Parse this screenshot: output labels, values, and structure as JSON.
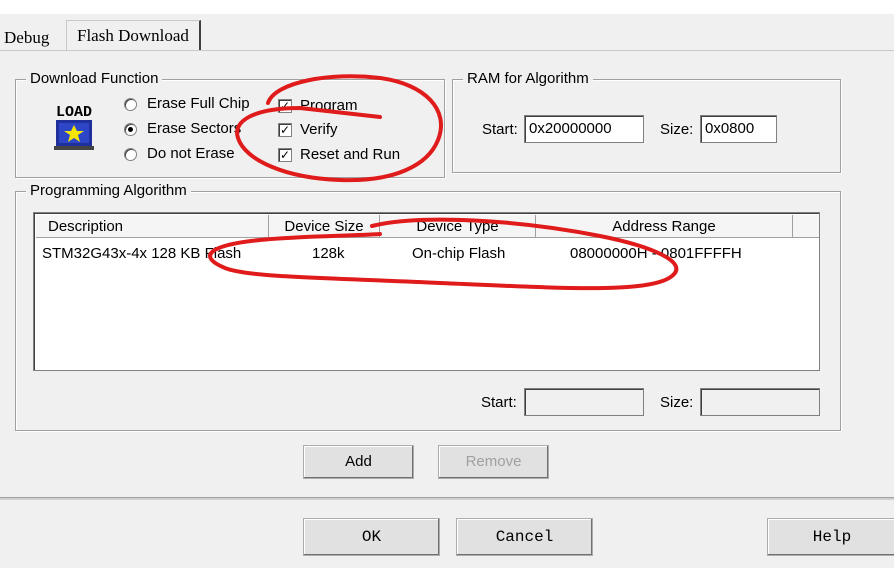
{
  "tabs": [
    {
      "label": "Debug"
    },
    {
      "label": "Flash Download"
    }
  ],
  "download_function": {
    "legend": "Download Function",
    "icon": "load-icon",
    "radios": [
      {
        "label": "Erase Full Chip",
        "selected": false
      },
      {
        "label": "Erase Sectors",
        "selected": true
      },
      {
        "label": "Do not Erase",
        "selected": false
      }
    ],
    "checks": [
      {
        "label": "Program",
        "checked": true
      },
      {
        "label": "Verify",
        "checked": true
      },
      {
        "label": "Reset and Run",
        "checked": true
      }
    ]
  },
  "ram": {
    "legend": "RAM for Algorithm",
    "start_label": "Start:",
    "start_value": "0x20000000",
    "size_label": "Size:",
    "size_value": "0x0800"
  },
  "programming": {
    "legend": "Programming Algorithm",
    "columns": [
      "Description",
      "Device Size",
      "Device Type",
      "Address Range"
    ],
    "rows": [
      {
        "description": "STM32G43x-4x 128 KB Flash",
        "size": "128k",
        "type": "On-chip Flash",
        "range": "08000000H - 0801FFFFH"
      }
    ],
    "start_label": "Start:",
    "start_value": "",
    "size_label": "Size:",
    "size_value": ""
  },
  "buttons": {
    "add": "Add",
    "remove": "Remove",
    "ok": "OK",
    "cancel": "Cancel",
    "help": "Help"
  },
  "colors": {
    "annotation": "#e01b1b"
  }
}
